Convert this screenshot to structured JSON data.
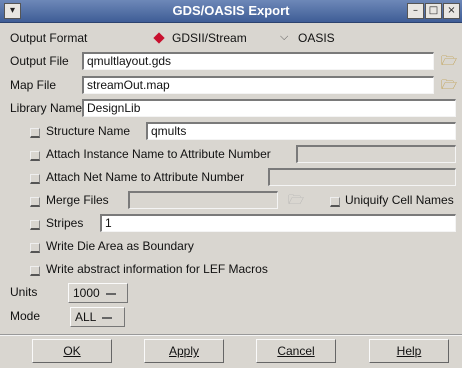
{
  "window": {
    "title": "GDS/OASIS Export",
    "menu_glyph": "▾",
    "min_glyph": "–",
    "max_glyph": "□",
    "close_glyph": "×"
  },
  "output_format": {
    "label": "Output Format",
    "option_gds": "GDSII/Stream",
    "option_oasis": "OASIS",
    "selected": "GDSII/Stream"
  },
  "output_file": {
    "label": "Output File",
    "value": "qmultlayout.gds"
  },
  "map_file": {
    "label": "Map File",
    "value": "streamOut.map"
  },
  "library_name": {
    "label": "Library Name",
    "value": "DesignLib"
  },
  "structure_name": {
    "label": "Structure Name",
    "value": "qmults",
    "checked": false
  },
  "attach_instance": {
    "label": "Attach Instance Name to Attribute Number",
    "value": "",
    "checked": false
  },
  "attach_net": {
    "label": "Attach Net Name to Attribute Number",
    "value": "",
    "checked": false
  },
  "merge_files": {
    "label": "Merge Files",
    "value": "",
    "checked": false
  },
  "uniquify": {
    "label": "Uniquify Cell Names",
    "checked": false
  },
  "stripes": {
    "label": "Stripes",
    "value": "1",
    "checked": false
  },
  "die_area": {
    "label": "Write Die Area as Boundary",
    "checked": false
  },
  "abstract_info": {
    "label": "Write abstract information for LEF Macros",
    "checked": false
  },
  "units": {
    "label": "Units",
    "value": "1000"
  },
  "mode": {
    "label": "Mode",
    "value": "ALL"
  },
  "buttons": {
    "ok": "OK",
    "apply": "Apply",
    "cancel": "Cancel",
    "help": "Help"
  },
  "icons": {
    "folder": "folder-open-icon"
  },
  "colors": {
    "title_bar": "#4a679f",
    "background": "#d9d6d0",
    "radio_selected": "#c8102e"
  }
}
